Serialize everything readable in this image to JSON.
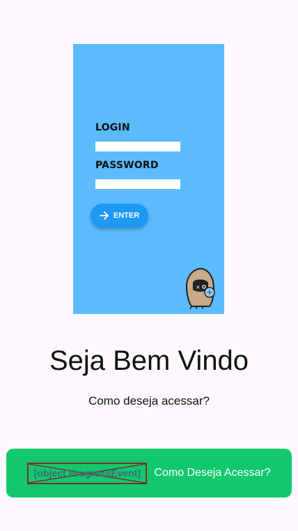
{
  "hero": {
    "login_label": "LOGIN",
    "password_label": "PASSWORD",
    "enter_label": "ENTER",
    "arrow_icon": "arrow-right-icon",
    "mascot_icon": "hooded-mascot-icon"
  },
  "welcome": {
    "title": "Seja Bem Vindo",
    "subtitle": "Como deseja acessar?"
  },
  "cta": {
    "image_alt": "[object ProgressEvent]",
    "label": "Como Deseja Acessar?",
    "color": "#13c86c"
  },
  "colors": {
    "background": "#fdf8fd",
    "hero_background": "#5bbbfd",
    "enter_button": "#1f99f6"
  }
}
